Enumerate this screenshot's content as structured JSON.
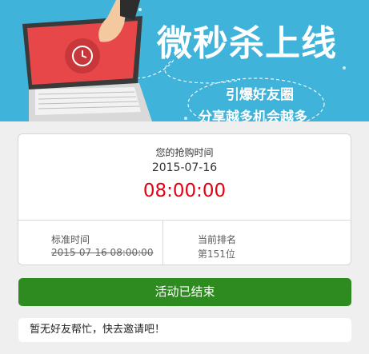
{
  "banner": {
    "title": "微秒杀上线",
    "line1": "引爆好友圈",
    "line2": "分享越多机会越多"
  },
  "card": {
    "purchase_time_label": "您的抢购时间",
    "purchase_date": "2015-07-16",
    "purchase_clock": "08:00:00",
    "standard_time_label": "标准时间",
    "standard_time_value": "2015-07-16 08:00:00",
    "rank_label": "当前排名",
    "rank_value": "第151位"
  },
  "action_button": {
    "label": "活动已结束"
  },
  "notice": {
    "text": "暂无好友帮忙，快去邀请吧！"
  },
  "colors": {
    "banner_bg": "#3fb3d9",
    "accent_red": "#e60012",
    "button_green": "#2e8b1f",
    "page_bg": "#efefef"
  }
}
